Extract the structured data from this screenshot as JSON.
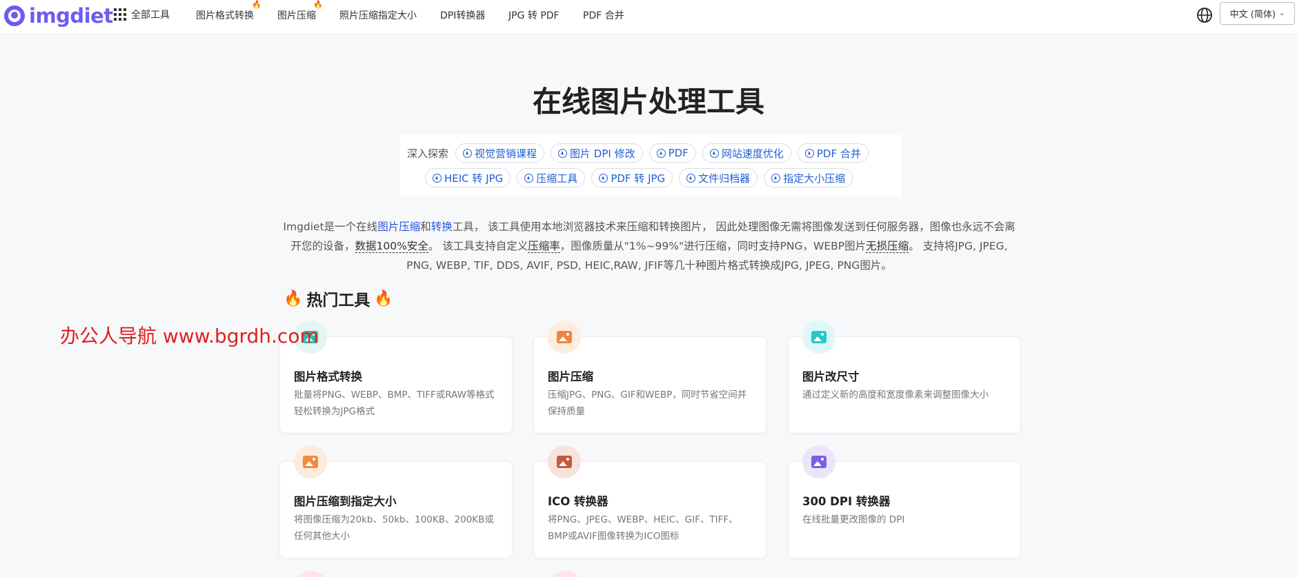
{
  "header": {
    "logo_text": "imgdiet",
    "all_tools": "全部工具",
    "nav": [
      {
        "label": "图片格式转换",
        "hot": true
      },
      {
        "label": "图片压缩",
        "hot": true
      },
      {
        "label": "照片压缩指定大小",
        "hot": false
      },
      {
        "label": "DPI转换器",
        "hot": false
      },
      {
        "label": "JPG 转 PDF",
        "hot": false
      },
      {
        "label": "PDF 合并",
        "hot": false
      }
    ],
    "language": "中文 (简体)",
    "fire_emoji": "🔥"
  },
  "main": {
    "title": "在线图片处理工具",
    "explore": {
      "label": "深入探索",
      "row1": [
        "视觉营销课程",
        "图片 DPI 修改",
        "PDF",
        "网站速度优化",
        "PDF 合并"
      ],
      "row2": [
        "HEIC 转 JPG",
        "压缩工具",
        "PDF 转 JPG",
        "文件归档器",
        "指定大小压缩"
      ]
    },
    "description": {
      "p1": "Imgdiet是一个在线",
      "link1": "图片压缩",
      "p2": "和",
      "link2": "转换",
      "p3": "工具， 该工具使用本地浏览器技术来压缩和转换图片， 因此处理图像无需将图像发送到任何服务器，图像也永远不会离开您的设备，",
      "u1": "数据100%安全",
      "p4": "。 该工具支持自定义",
      "u2": "压缩率",
      "p5": "，图像质量从\"1%~99%\"进行压缩，同时支持PNG，WEBP图片",
      "u3": "无损压缩",
      "p6": "。 支持将JPG, JPEG, PNG, WEBP, TIF, DDS, AVIF, PSD, HEIC,RAW, JFIF等几十种图片格式转换成JPG, JPEG, PNG图片。"
    },
    "hot_tools_title": "热门工具",
    "hot_tools_emoji": "🔥",
    "cards": [
      {
        "title": "图片格式转换",
        "desc": "批量将PNG、WEBP、BMP、TIFF或RAW等格式轻松转换为JPG格式",
        "color": "#2fb9a8",
        "bg": "#e3f6f3"
      },
      {
        "title": "图片压缩",
        "desc": "压缩JPG、PNG、GIF和WEBP，同时节省空间并保持质量",
        "color": "#f2843a",
        "bg": "#fdece0"
      },
      {
        "title": "图片改尺寸",
        "desc": "通过定义新的高度和宽度像素来调整图像大小",
        "color": "#24c9c6",
        "bg": "#e0f7f7"
      },
      {
        "title": "图片压缩到指定大小",
        "desc": "将图像压缩为20kb、50kb、100KB、200KB或任何其他大小",
        "color": "#f38b40",
        "bg": "#fdebde"
      },
      {
        "title": "ICO 转换器",
        "desc": "将PNG、JPEG、WEBP、HEIC、GIF、TIFF、BMP或AVIF图像转换为ICO图标",
        "color": "#c45a3e",
        "bg": "#f7e3de"
      },
      {
        "title": "300 DPI 转换器",
        "desc": "在线批量更改图像的 DPI",
        "color": "#7a5ee6",
        "bg": "#ebe5fb"
      }
    ]
  },
  "watermark": "办公人导航 www.bgrdh.com"
}
